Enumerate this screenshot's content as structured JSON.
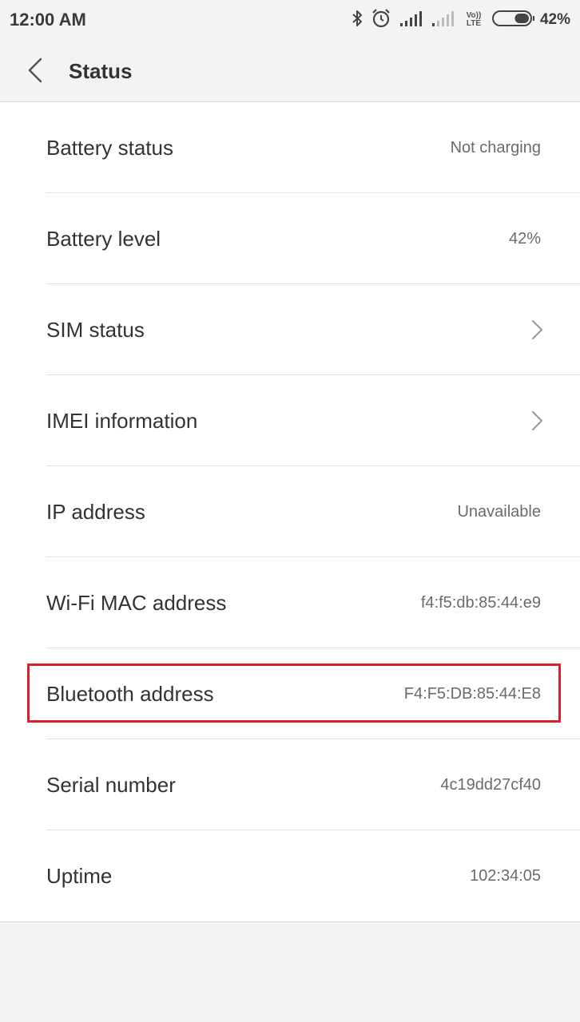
{
  "status_bar": {
    "time": "12:00 AM",
    "icons": [
      "bluetooth-icon",
      "alarm-icon",
      "signal-strong-icon",
      "signal-weak-icon",
      "volte-icon",
      "battery-icon"
    ],
    "volte_line1": "Vo))",
    "volte_line2": "LTE",
    "battery_percent": "42%",
    "battery_level": 0.42
  },
  "header": {
    "title": "Status",
    "back_icon": "chevron-left-icon"
  },
  "rows": [
    {
      "label": "Battery status",
      "value": "Not charging",
      "chevron": false
    },
    {
      "label": "Battery level",
      "value": "42%",
      "chevron": false
    },
    {
      "label": "SIM status",
      "value": "",
      "chevron": true
    },
    {
      "label": "IMEI information",
      "value": "",
      "chevron": true
    },
    {
      "label": "IP address",
      "value": "Unavailable",
      "chevron": false
    },
    {
      "label": "Wi-Fi MAC address",
      "value": "f4:f5:db:85:44:e9",
      "chevron": false
    },
    {
      "label": "Bluetooth address",
      "value": "F4:F5:DB:85:44:E8",
      "chevron": false,
      "highlighted": true
    },
    {
      "label": "Serial number",
      "value": "4c19dd27cf40",
      "chevron": false
    },
    {
      "label": "Uptime",
      "value": "102:34:05",
      "chevron": false
    }
  ],
  "colors": {
    "background": "#f3f3f3",
    "list_background": "#ffffff",
    "highlight": "#d8202a",
    "text_primary": "#333333",
    "text_secondary": "#6b6b6b"
  }
}
